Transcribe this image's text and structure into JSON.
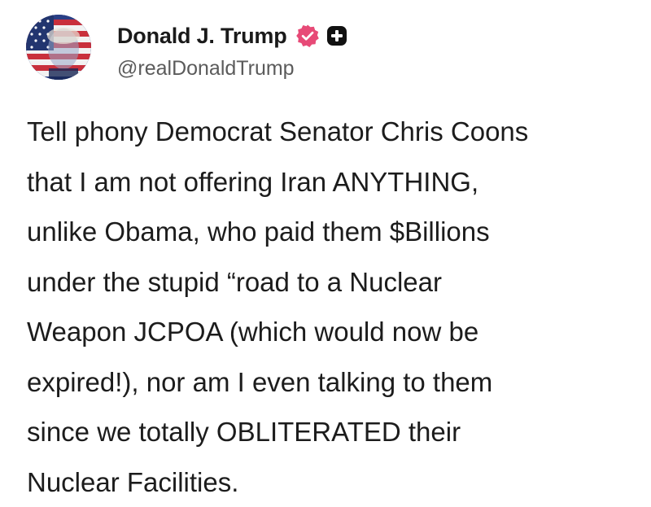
{
  "post": {
    "author": {
      "display_name": "Donald J. Trump",
      "handle": "@realDonaldTrump",
      "avatar_icon": "flag-portrait-avatar",
      "verified_icon": "verified-badge-icon",
      "plus_icon": "plus-badge-icon"
    },
    "body_lines": [
      "Tell phony Democrat Senator Chris Coons",
      "that I am not offering Iran ANYTHING,",
      "unlike Obama, who paid them $Billions",
      "under the stupid “road to a Nuclear",
      "Weapon JCPOA (which would now be",
      "expired!), nor am I even talking to them",
      "since we totally OBLITERATED their",
      "Nuclear Facilities."
    ]
  },
  "colors": {
    "verified_badge": "#e74a77",
    "plus_badge": "#111111",
    "text": "#1c1c1c",
    "handle": "#5b5b5b"
  }
}
